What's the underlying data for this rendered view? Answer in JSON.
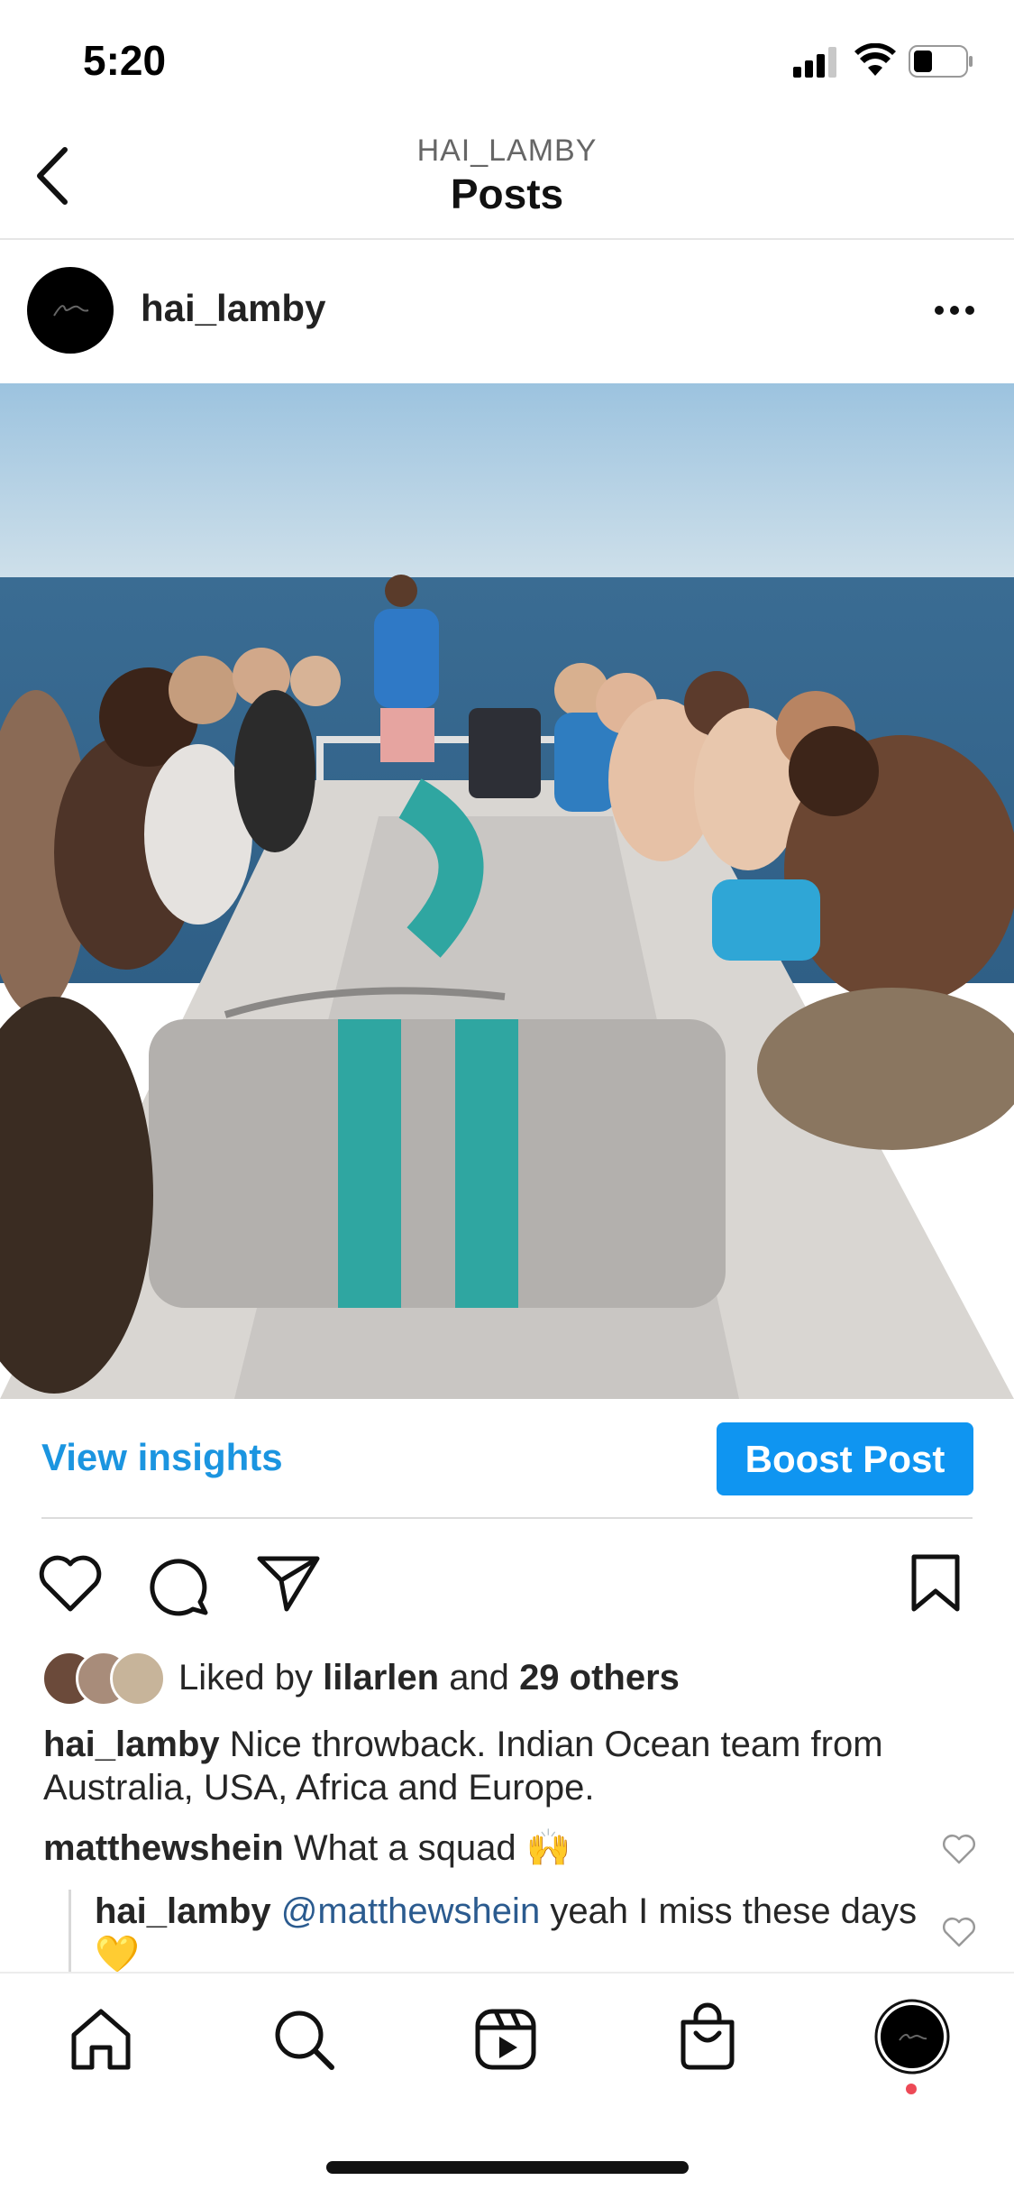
{
  "status_bar": {
    "time": "5:20"
  },
  "header": {
    "subtitle": "HAI_LAMBY",
    "title": "Posts"
  },
  "post": {
    "username": "hai_lamby",
    "view_insights_label": "View insights",
    "boost_label": "Boost Post",
    "likes": {
      "prefix": "Liked by",
      "user": "lilarlen",
      "middle": "and",
      "others": "29 others"
    },
    "caption": {
      "user": "hai_lamby",
      "text": "Nice throwback. Indian Ocean team from Australia, USA, Africa and Europe."
    },
    "comments": [
      {
        "user": "matthewshein",
        "text": "What a squad 🙌"
      }
    ],
    "reply": {
      "user": "hai_lamby",
      "mention": "@matthewshein",
      "text": "yeah I miss these days 💛"
    }
  },
  "colors": {
    "accent": "#0f95f1",
    "link": "#1b95e0",
    "notification_dot": "#ed4956"
  },
  "icons": [
    "back-icon",
    "more-icon",
    "heart-icon",
    "comment-icon",
    "share-icon",
    "bookmark-icon",
    "home-icon",
    "search-icon",
    "reels-icon",
    "shop-icon",
    "profile-icon"
  ]
}
